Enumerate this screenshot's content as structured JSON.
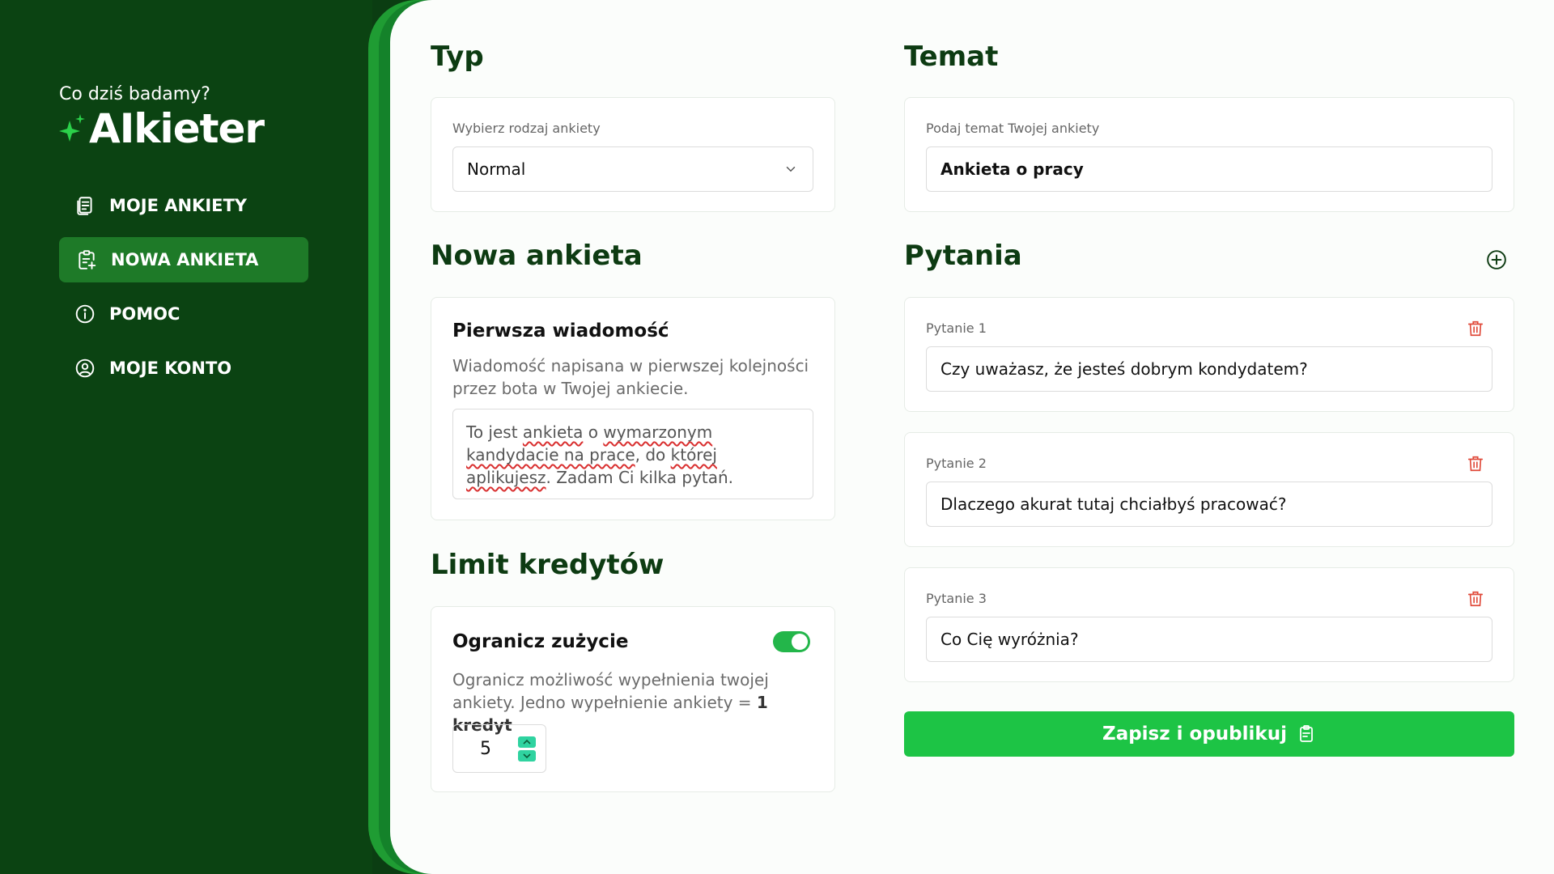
{
  "sidebar": {
    "tagline": "Co dziś badamy?",
    "brand": "AIkieter",
    "items": [
      {
        "label": "MOJE ANKIETY",
        "icon": "document-list-icon",
        "active": false
      },
      {
        "label": "NOWA ANKIETA",
        "icon": "clipboard-add-icon",
        "active": true
      },
      {
        "label": "POMOC",
        "icon": "info-icon",
        "active": false
      },
      {
        "label": "MOJE KONTO",
        "icon": "user-circle-icon",
        "active": false
      }
    ]
  },
  "typ": {
    "heading": "Typ",
    "label": "Wybierz rodzaj ankiety",
    "selected": "Normal"
  },
  "temat": {
    "heading": "Temat",
    "label": "Podaj temat Twojej ankiety",
    "value": "Ankieta o pracy"
  },
  "nowa": {
    "heading": "Nowa ankieta",
    "card_title": "Pierwsza wiadomość",
    "card_desc": "Wiadomość napisana w pierwszej kolejności przez bota w Twojej ankiecie.",
    "message": {
      "p1": "To jest ",
      "w1": "ankieta",
      "p2": " o ",
      "w2": "wymarzonym",
      "p3": " ",
      "w3": "kandydacie na prace",
      "p4": ", do ",
      "w4": "której aplikujesz",
      "p5": ". Zadam Ci kilka pytań."
    }
  },
  "limit": {
    "heading": "Limit kredytów",
    "card_title": "Ogranicz zużycie",
    "desc_prefix": "Ogranicz możliwość wypełnienia twojej ankiety. Jedno wypełnienie ankiety = ",
    "desc_bold": "1 kredyt",
    "enabled": true,
    "value": "5"
  },
  "pytania": {
    "heading": "Pytania",
    "items": [
      {
        "label": "Pytanie 1",
        "value": "Czy uważasz, że jesteś dobrym kondydatem?"
      },
      {
        "label": "Pytanie 2",
        "value": "Dlaczego akurat tutaj chciałbyś pracować?"
      },
      {
        "label": "Pytanie 3",
        "value": "Co Cię wyróżnia?"
      }
    ]
  },
  "publish": {
    "label": "Zapisz i opublikuj",
    "icon": "clipboard-check-icon"
  },
  "colors": {
    "sidebar_bg": "#0b4312",
    "active_item": "#1e7a28",
    "accent_green": "#1dc445",
    "heading": "#0d3b12",
    "trash_red": "#e04a3a"
  }
}
